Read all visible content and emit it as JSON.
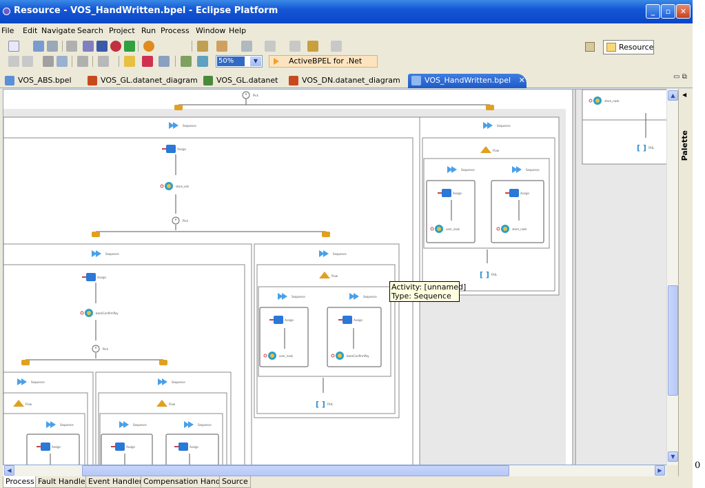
{
  "window": {
    "title": "Resource - VOS_HandWritten.bpel - Eclipse Platform",
    "minimize": "_",
    "maximize": "▫",
    "close": "✕"
  },
  "menu": [
    "File",
    "Edit",
    "Navigate",
    "Search",
    "Project",
    "Run",
    "Process",
    "Window",
    "Help"
  ],
  "toolbar": {
    "zoom": "50%",
    "engine": "ActiveBPEL for .Net",
    "perspective": "Resource"
  },
  "editor_tabs": [
    {
      "label": "VOS_ABS.bpel",
      "icon_color": "#5b8fd8"
    },
    {
      "label": "VOS_GL.datanet_diagram",
      "icon_color": "#c84a1c"
    },
    {
      "label": "VOS_GL.datanet",
      "icon_color": "#4a8a3a"
    },
    {
      "label": "VOS_DN.datanet_diagram",
      "icon_color": "#c84a1c"
    },
    {
      "label": "VOS_HandWritten.bpel",
      "icon_color": "#5b8fd8",
      "active": true,
      "close": "✕"
    }
  ],
  "tab_controls": "▭ ⧉",
  "palette": {
    "label": "Palette"
  },
  "tooltip": {
    "line1": "Activity: [unnamed]",
    "line2": "Type: Sequence"
  },
  "bottom_tabs": [
    "Process",
    "Fault Handlers",
    "Event Handlers",
    "Compensation Handler",
    "Source"
  ],
  "margin_label": "0",
  "colors": {
    "accent": "#1e5bc8",
    "assign": "#2a78d8",
    "flow": "#e0a020",
    "sequence": "#4aa0e8",
    "invoke": "#2aa0c8"
  },
  "nodes": {
    "pick": "Pick",
    "sequence": "Sequence",
    "assign": "Assign",
    "flow": "Flow",
    "fail": "FAIL",
    "store_ask": "store_ask",
    "store_nask": "store_nask",
    "user_nask": "user_nask",
    "bankConfirmPay": "bankConfirmPay"
  }
}
